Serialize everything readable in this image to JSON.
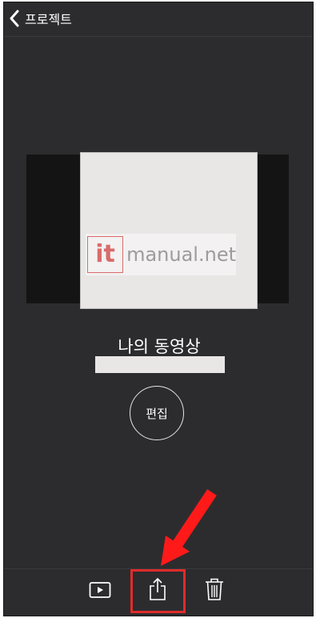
{
  "navbar": {
    "back_label": "프로젝트"
  },
  "preview": {
    "watermark_logo": "it",
    "watermark_text": "manual.net"
  },
  "project": {
    "title": "나의 동영상",
    "edit_label": "편집"
  },
  "toolbar": {
    "items": [
      {
        "icon": "play-icon"
      },
      {
        "icon": "share-icon"
      },
      {
        "icon": "trash-icon"
      }
    ]
  },
  "colors": {
    "background": "#2c2c2e",
    "text": "#ffffff",
    "highlight": "#e02b2b",
    "arrow": "#ff1a1a"
  }
}
